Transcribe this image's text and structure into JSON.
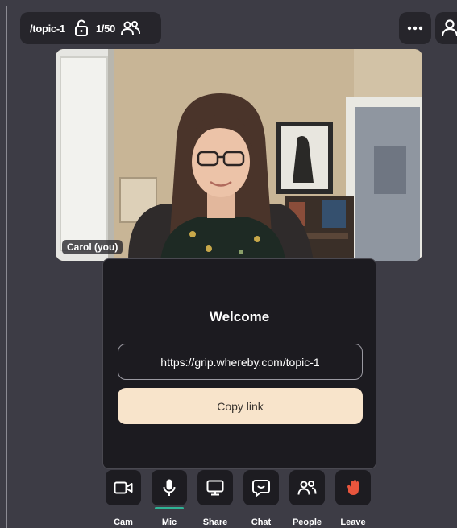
{
  "room": {
    "name": "/topic-1",
    "participants": "1/50"
  },
  "video": {
    "self_label": "Carol (you)"
  },
  "welcome": {
    "title": "Welcome",
    "url": "https://grip.whereby.com/topic-1",
    "copy_label": "Copy link"
  },
  "controls": [
    {
      "label": "Cam",
      "icon": "camera-icon"
    },
    {
      "label": "Mic",
      "icon": "microphone-icon",
      "active": true
    },
    {
      "label": "Share",
      "icon": "screen-share-icon"
    },
    {
      "label": "Chat",
      "icon": "chat-icon"
    },
    {
      "label": "People",
      "icon": "people-icon"
    },
    {
      "label": "Leave",
      "icon": "leave-hand-icon"
    }
  ],
  "colors": {
    "background": "#3d3c45",
    "panel": "#1c1b20",
    "accent_active": "#2fb395",
    "copy_button": "#f8e4cb",
    "leave_icon": "#e8553d"
  }
}
